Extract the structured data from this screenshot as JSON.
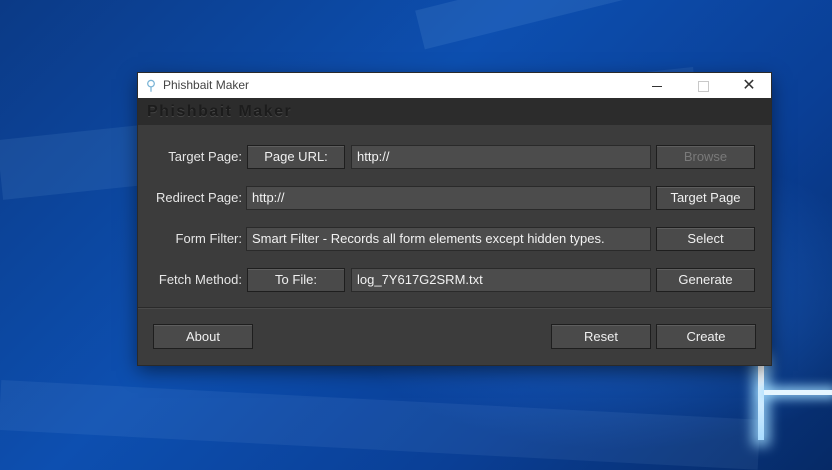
{
  "window": {
    "title": "Phishbait Maker",
    "brand": "Phishbait Maker",
    "controls": {
      "minimize_icon": "minimize-icon",
      "maximize_icon": "maximize-icon",
      "close_icon": "close-icon",
      "close_glyph": "✕"
    },
    "app_icon_glyph": "⚲"
  },
  "rows": {
    "target_page": {
      "label": "Target Page:",
      "mode_button": "Page URL:",
      "value": "http://",
      "action_button": "Browse",
      "action_disabled": true
    },
    "redirect_page": {
      "label": "Redirect Page:",
      "value": "http://",
      "action_button": "Target Page"
    },
    "form_filter": {
      "label": "Form Filter:",
      "value": "Smart Filter - Records all form elements except hidden types.",
      "action_button": "Select"
    },
    "fetch_method": {
      "label": "Fetch Method:",
      "mode_button": "To File:",
      "value": "log_7Y617G2SRM.txt",
      "action_button": "Generate"
    }
  },
  "footer": {
    "about": "About",
    "reset": "Reset",
    "create": "Create"
  },
  "colors": {
    "window_bg": "#3c3c3c",
    "header_bg": "#2c2c2c",
    "button_bg": "#4a4a4a",
    "field_bg": "#4c4c4c",
    "text": "#f0f0f0",
    "disabled_text": "#7a7a7a"
  }
}
